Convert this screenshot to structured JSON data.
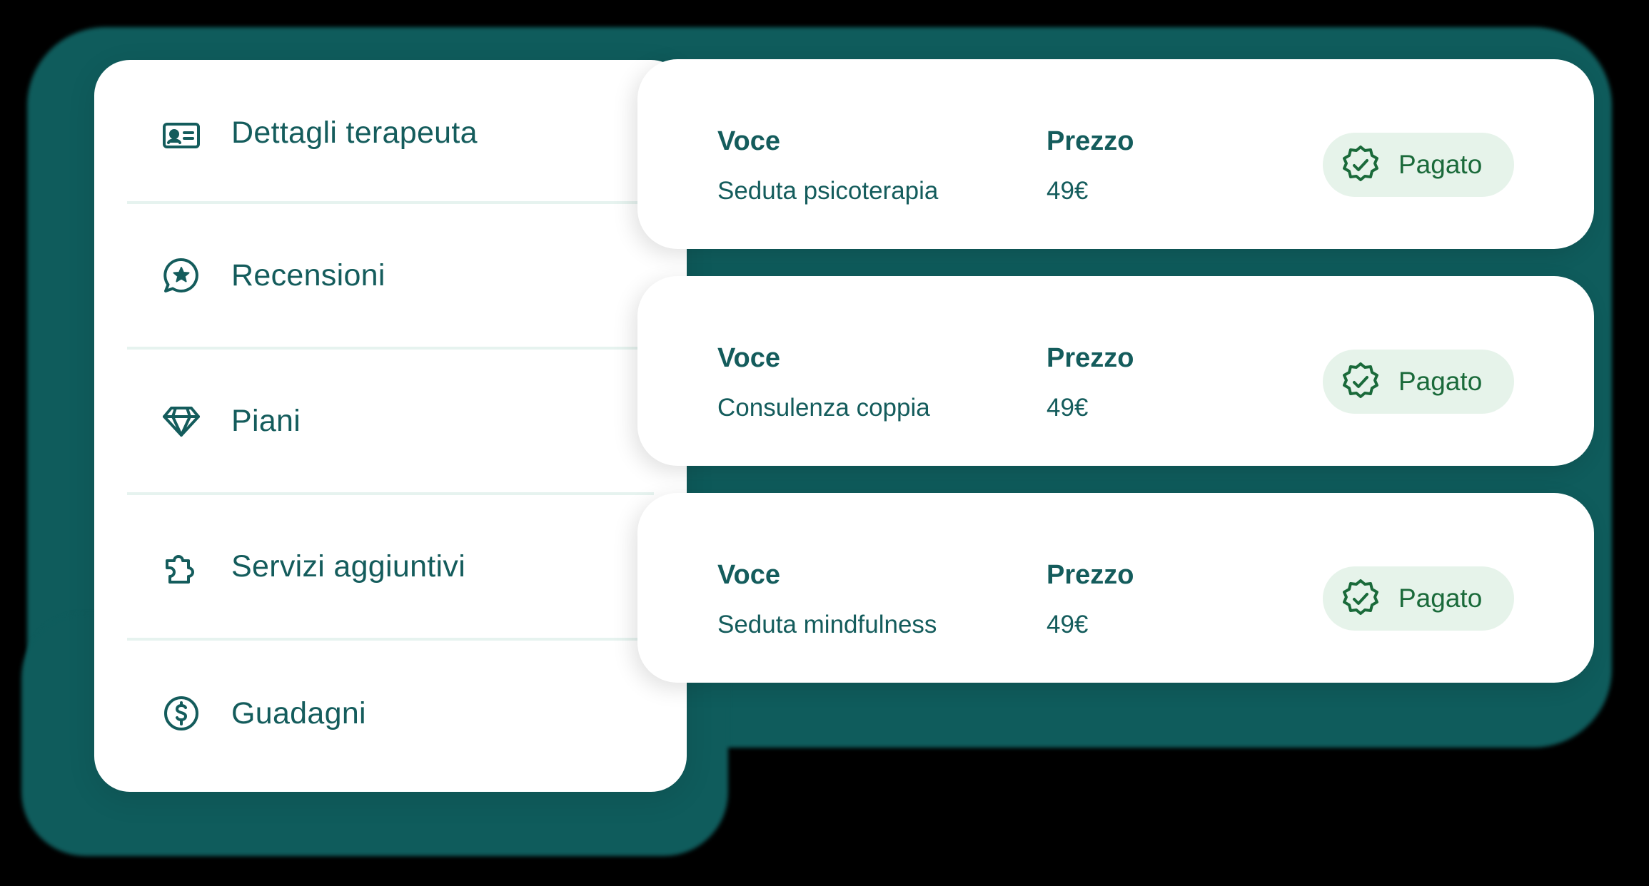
{
  "nav": {
    "items": [
      {
        "label": "Dettagli terapeuta",
        "icon": "id-card-icon"
      },
      {
        "label": "Recensioni",
        "icon": "star-chat-icon"
      },
      {
        "label": "Piani",
        "icon": "diamond-icon"
      },
      {
        "label": "Servizi aggiuntivi",
        "icon": "puzzle-icon"
      },
      {
        "label": "Guadagni",
        "icon": "dollar-coin-icon"
      }
    ]
  },
  "payments": [
    {
      "voce_header": "Voce",
      "prezzo_header": "Prezzo",
      "voce": "Seduta psicoterapia",
      "prezzo": "49€",
      "status": "Pagato",
      "status_icon": "verified-badge-icon"
    },
    {
      "voce_header": "Voce",
      "prezzo_header": "Prezzo",
      "voce": "Consulenza coppia",
      "prezzo": "49€",
      "status": "Pagato",
      "status_icon": "verified-badge-icon"
    },
    {
      "voce_header": "Voce",
      "prezzo_header": "Prezzo",
      "voce": "Seduta mindfulness",
      "prezzo": "49€",
      "status": "Pagato",
      "status_icon": "verified-badge-icon"
    }
  ],
  "colors": {
    "backdrop": "#0f5c5c",
    "text_primary": "#145c5c",
    "badge_bg": "#e6f3ea",
    "badge_text": "#1a6a3a",
    "divider": "#e6f3ef"
  }
}
